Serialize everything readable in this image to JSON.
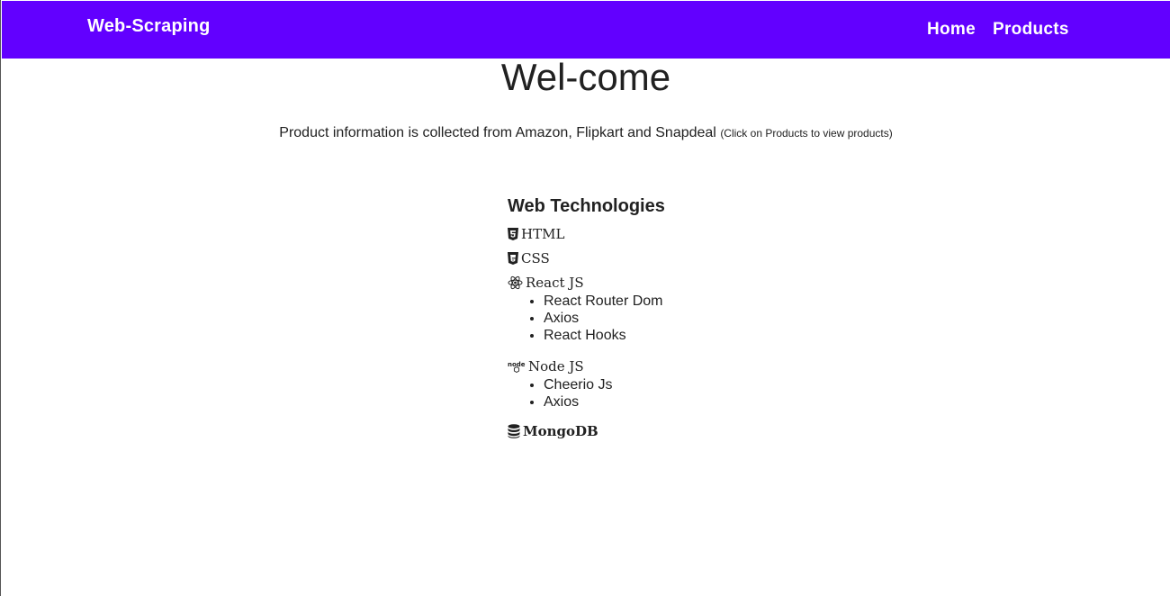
{
  "navbar": {
    "brand": "Web-Scraping",
    "links": [
      "Home",
      "Products"
    ],
    "background": "#6200ff"
  },
  "main": {
    "heading": "Wel-come",
    "intro": "Product information is collected from Amazon, Flipkart and Snapdeal",
    "intro_note": "(Click on Products to view products)"
  },
  "tech": {
    "title": "Web Technologies",
    "html": {
      "label": "HTML",
      "icon": "html5-icon"
    },
    "css": {
      "label": "CSS",
      "icon": "css3-icon"
    },
    "react": {
      "label": "React JS",
      "icon": "react-icon",
      "items": [
        "React Router Dom",
        "Axios",
        "React Hooks"
      ]
    },
    "node": {
      "label": "Node JS",
      "icon": "nodejs-icon",
      "items": [
        "Cheerio Js",
        "Axios"
      ]
    },
    "mongo": {
      "label": "MongoDB",
      "icon": "database-icon"
    }
  }
}
